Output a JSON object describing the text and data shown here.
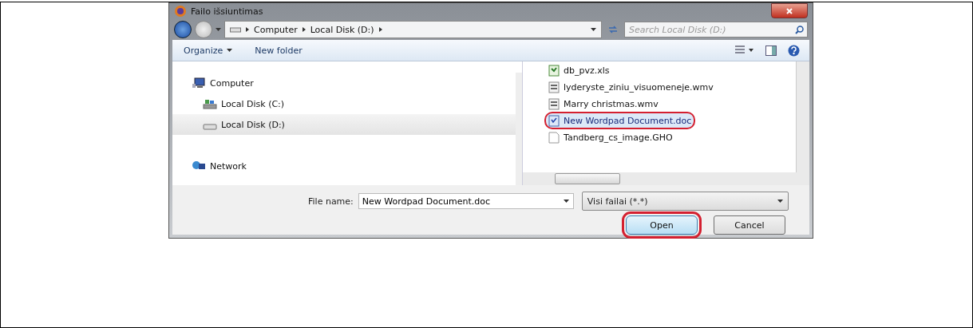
{
  "window": {
    "title": "Failo išsiuntimas"
  },
  "address": {
    "crumbs": [
      "Computer",
      "Local Disk (D:)"
    ]
  },
  "search": {
    "placeholder": "Search Local Disk (D:)"
  },
  "toolbar": {
    "organize": "Organize",
    "new_folder": "New folder"
  },
  "sidebar": {
    "items": [
      {
        "label": "Computer",
        "kind": "computer",
        "selected": false,
        "children": [
          {
            "label": "Local Disk (C:)",
            "kind": "system-drive",
            "selected": false
          },
          {
            "label": "Local Disk (D:)",
            "kind": "drive",
            "selected": true
          }
        ]
      },
      {
        "label": "Network",
        "kind": "network",
        "selected": false
      }
    ]
  },
  "files": [
    {
      "name": "db_pvz.xls",
      "kind": "sheet",
      "selected": false,
      "circled": false
    },
    {
      "name": "lyderyste_ziniu_visuomeneje.wmv",
      "kind": "video",
      "selected": false,
      "circled": false
    },
    {
      "name": "Marry christmas.wmv",
      "kind": "video",
      "selected": false,
      "circled": false
    },
    {
      "name": "New Wordpad Document.doc",
      "kind": "doc",
      "selected": true,
      "circled": true
    },
    {
      "name": "Tandberg_cs_image.GHO",
      "kind": "blank",
      "selected": false,
      "circled": false
    }
  ],
  "file_name": {
    "label": "File name:",
    "value": "New Wordpad Document.doc"
  },
  "file_type": {
    "value": "Visi failai (*.*)"
  },
  "buttons": [
    {
      "label": "Open",
      "kind": "default",
      "circled": true
    },
    {
      "label": "Cancel",
      "kind": "normal",
      "circled": false
    }
  ]
}
